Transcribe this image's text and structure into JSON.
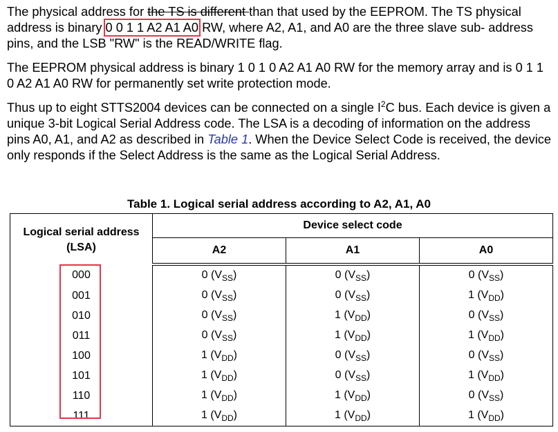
{
  "paragraph1": {
    "pre": "The physical address for ",
    "struck": "the TS is different ",
    "mid": "than that used by the EEPROM. The TS physical address is binary ",
    "boxed": "0 0 1 1 A2 A1 A0",
    "post": " RW, where A2, A1, and A0 are the three slave sub- address pins, and the LSB \"RW\" is the READ/WRITE flag."
  },
  "paragraph2": "The EEPROM physical address is binary 1 0 1 0 A2 A1 A0 RW for the memory array and is 0 1 1 0 A2 A1 A0 RW for permanently set write protection mode.",
  "paragraph3": {
    "pre": "Thus  up to eight STTS2004 devices can be connected on a single I",
    "sup": "2",
    "mid": "C bus. Each device  is given a unique 3-bit Logical Serial Address code.  The LSA is a decoding of information on the address pins A0, A1, and A2 as described in ",
    "link": "Table 1",
    "post": ".  When the Device Select Code is received, the device only responds if the Select Address is the same as the Logical Serial Address."
  },
  "table": {
    "caption": "Table 1. Logical serial address according to A2, A1, A0",
    "lsa_header_line1": "Logical serial address",
    "lsa_header_line2": "(LSA)",
    "group_header": "Device select code",
    "col_headers": [
      "A2",
      "A1",
      "A0"
    ],
    "rows": [
      {
        "lsa": "000",
        "a2": [
          "0 (V",
          "SS",
          ")"
        ],
        "a1": [
          "0 (V",
          "SS",
          ")"
        ],
        "a0": [
          "0 (V",
          "SS",
          ")"
        ]
      },
      {
        "lsa": "001",
        "a2": [
          "0 (V",
          "SS",
          ")"
        ],
        "a1": [
          "0 (V",
          "SS",
          ")"
        ],
        "a0": [
          "1 (V",
          "DD",
          ")"
        ]
      },
      {
        "lsa": "010",
        "a2": [
          "0 (V",
          "SS",
          ")"
        ],
        "a1": [
          "1 (V",
          "DD",
          ")"
        ],
        "a0": [
          "0 (V",
          "SS",
          ")"
        ]
      },
      {
        "lsa": "011",
        "a2": [
          "0 (V",
          "SS",
          ")"
        ],
        "a1": [
          "1 (V",
          "DD",
          ")"
        ],
        "a0": [
          "1 (V",
          "DD",
          ")"
        ]
      },
      {
        "lsa": "100",
        "a2": [
          "1 (V",
          "DD",
          ")"
        ],
        "a1": [
          "0 (V",
          "SS",
          ")"
        ],
        "a0": [
          "0 (V",
          "SS",
          ")"
        ]
      },
      {
        "lsa": "101",
        "a2": [
          "1 (V",
          "DD",
          ")"
        ],
        "a1": [
          "0 (V",
          "SS",
          ")"
        ],
        "a0": [
          "1 (V",
          "DD",
          ")"
        ]
      },
      {
        "lsa": "110",
        "a2": [
          "1 (V",
          "DD",
          ")"
        ],
        "a1": [
          "1 (V",
          "DD",
          ")"
        ],
        "a0": [
          "0 (V",
          "SS",
          ")"
        ]
      },
      {
        "lsa": "111",
        "a2": [
          "1 (V",
          "DD",
          ")"
        ],
        "a1": [
          "1 (V",
          "DD",
          ")"
        ],
        "a0": [
          "1 (V",
          "DD",
          ")"
        ]
      }
    ]
  },
  "colors": {
    "highlight_box": "#e8334a",
    "link": "#2a3a9b"
  }
}
